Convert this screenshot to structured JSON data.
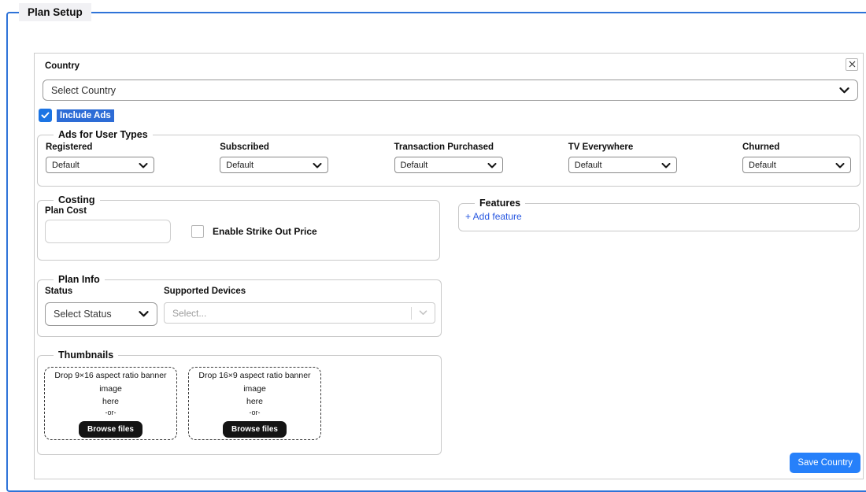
{
  "page": {
    "legend": "Plan Setup"
  },
  "panel": {
    "country": {
      "label": "Country",
      "selected": "Select Country"
    },
    "include_ads": {
      "label": "Include Ads",
      "checked": true
    },
    "ads": {
      "legend": "Ads for User Types",
      "fields": [
        {
          "label": "Registered",
          "value": "Default"
        },
        {
          "label": "Subscribed",
          "value": "Default"
        },
        {
          "label": "Transaction Purchased",
          "value": "Default"
        },
        {
          "label": "TV Everywhere",
          "value": "Default"
        },
        {
          "label": "Churned",
          "value": "Default"
        }
      ]
    },
    "costing": {
      "legend": "Costing",
      "plan_cost_label": "Plan Cost",
      "plan_cost_value": "",
      "strike_out_label": "Enable Strike Out Price",
      "strike_out_checked": false
    },
    "features": {
      "legend": "Features",
      "add_link": "+ Add feature"
    },
    "plan_info": {
      "legend": "Plan Info",
      "status_label": "Status",
      "status_value": "Select Status",
      "devices_label": "Supported Devices",
      "devices_placeholder": "Select..."
    },
    "thumbnails": {
      "legend": "Thumbnails",
      "zones": [
        {
          "line1": "Drop 9×16 aspect ratio banner image",
          "line2": "here",
          "separator": "-or-",
          "button": "Browse files"
        },
        {
          "line1": "Drop 16×9 aspect ratio banner image",
          "line2": "here",
          "separator": "-or-",
          "button": "Browse files"
        }
      ]
    },
    "save_button": "Save Country"
  },
  "colors": {
    "accent-blue": "#2e73d8",
    "checkbox-blue": "#1b74e4",
    "highlight-blue": "#2d6cd6",
    "link-blue": "#2757e0",
    "save-blue": "#2680fa"
  }
}
